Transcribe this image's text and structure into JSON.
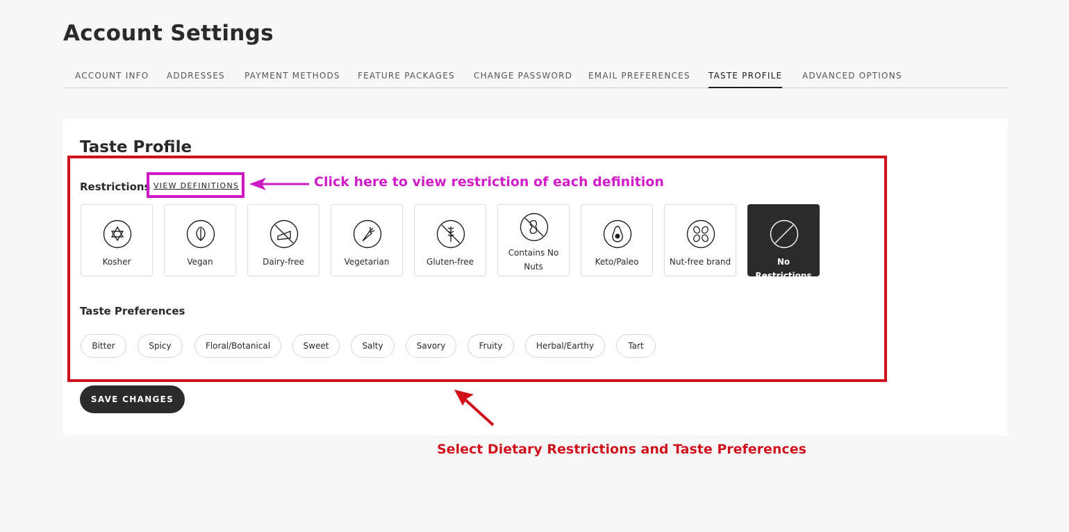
{
  "page": {
    "title": "Account Settings"
  },
  "tabs": [
    {
      "label": "ACCOUNT INFO",
      "active": false
    },
    {
      "label": "ADDRESSES",
      "active": false
    },
    {
      "label": "PAYMENT METHODS",
      "active": false
    },
    {
      "label": "FEATURE PACKAGES",
      "active": false
    },
    {
      "label": "CHANGE PASSWORD",
      "active": false
    },
    {
      "label": "EMAIL PREFERENCES",
      "active": false
    },
    {
      "label": "TASTE PROFILE",
      "active": true
    },
    {
      "label": "ADVANCED OPTIONS",
      "active": false
    }
  ],
  "taste_profile": {
    "title": "Taste Profile",
    "restrictions_label": "Restrictions",
    "view_definitions": "VIEW DEFINITIONS",
    "restrictions": [
      {
        "label": "Kosher",
        "icon": "star-of-david-icon",
        "selected": false
      },
      {
        "label": "Vegan",
        "icon": "leaf-icon",
        "selected": false
      },
      {
        "label": "Dairy-free",
        "icon": "no-cheese-icon",
        "selected": false
      },
      {
        "label": "Vegetarian",
        "icon": "carrot-icon",
        "selected": false
      },
      {
        "label": "Gluten-free",
        "icon": "no-wheat-icon",
        "selected": false
      },
      {
        "label": "Contains No Nuts",
        "icon": "no-peanut-icon",
        "selected": false
      },
      {
        "label": "Keto/Paleo",
        "icon": "avocado-icon",
        "selected": false
      },
      {
        "label": "Nut-free brand",
        "icon": "nuts-icon",
        "selected": false
      },
      {
        "label": "No Restrictions",
        "icon": "no-symbol-icon",
        "selected": true
      }
    ],
    "preferences_label": "Taste Preferences",
    "preferences": [
      "Bitter",
      "Spicy",
      "Floral/Botanical",
      "Sweet",
      "Salty",
      "Savory",
      "Fruity",
      "Herbal/Earthy",
      "Tart"
    ],
    "save_label": "SAVE CHANGES"
  },
  "annotations": {
    "view_definitions_hint": "Click here to view restriction of each definition",
    "select_hint": "Select Dietary Restrictions and Taste Preferences"
  },
  "colors": {
    "accent_dark": "#2b2b2b",
    "annotation_red": "#d0111b",
    "annotation_pink": "#cc19c4"
  }
}
